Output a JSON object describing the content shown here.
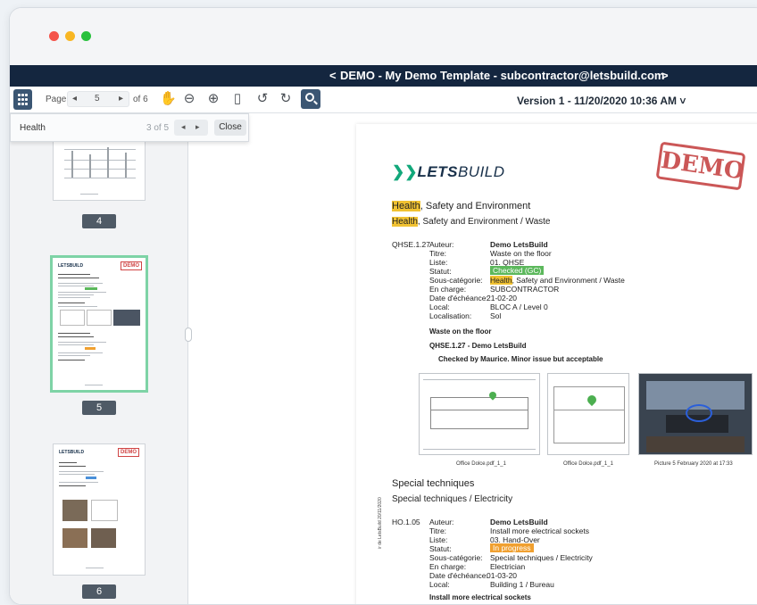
{
  "window": {
    "nav_prev": "<",
    "nav_title": "DEMO - My Demo Template - subcontractor@letsbuild.com",
    "nav_next": ">"
  },
  "toolbar": {
    "page_label": "Page",
    "page_prev": "◂",
    "page_value": "5",
    "page_next": "▸",
    "of_label": "of 6",
    "hand_icon": "✋",
    "zoom_out": "⊖",
    "zoom_in": "⊕",
    "fit_icon": "▯",
    "rotate_left": "↺",
    "rotate_right": "↻",
    "version": "Version 1 - 11/20/2020 10:36 AM ˅"
  },
  "search": {
    "query": "Health",
    "count": "3 of 5",
    "prev": "◂",
    "next": "▸",
    "close_label": "Close"
  },
  "thumbnails": [
    {
      "number": "4"
    },
    {
      "number": "5",
      "selected": true
    },
    {
      "number": "6"
    }
  ],
  "thumb_text": {
    "logo": "LETSBUILD",
    "demo": "DEMO"
  },
  "document": {
    "logo_mark": "❯❯",
    "logo_bold": "LETS",
    "logo_light": "BUILD",
    "stamp": "DEMO",
    "section1_hl": "Health",
    "section1_rest": ", Safety and Environment",
    "section1_sub_hl": "Health",
    "section1_sub_rest": ", Safety and Environment / Waste",
    "issue1": {
      "code": "QHSE.1.27",
      "labels": [
        "Auteur:",
        "Titre:",
        "Liste:",
        "Statut:",
        "Sous-catégorie:",
        "En charge:",
        "Date d'échéance:",
        "Local:",
        "Localisation:"
      ],
      "auteur": "Demo LetsBuild",
      "titre": "Waste on the floor",
      "liste": "01. QHSE",
      "statut": "Checked (GC)",
      "statut_color": "#5cb85c",
      "souscat_hl": "Health",
      "souscat_rest": ", Safety and Environment / Waste",
      "en_charge": "SUBCONTRACTOR",
      "date": "21-02-20",
      "local": "BLOC A / Level 0",
      "localisation": "Sol",
      "heading": "Waste on the floor",
      "comment_title": "QHSE.1.27 - Demo LetsBuild",
      "comment": "Checked by Maurice. Minor issue but acceptable",
      "captions": [
        "Office Dolce.pdf_1_1",
        "Office Dolce.pdf_1_1",
        "Picture 5 February 2020 at 17:33"
      ]
    },
    "section2": "Special techniques",
    "section2_sub": "Special techniques / Electricity",
    "issue2": {
      "code": "HO.1.05",
      "labels": [
        "Auteur:",
        "Titre:",
        "Liste:",
        "Statut:",
        "Sous-catégorie:",
        "En charge:",
        "Date d'échéance:",
        "Local:"
      ],
      "auteur": "Demo LetsBuild",
      "titre": "Install more electrical sockets",
      "liste": "03. Hand-Over",
      "statut": "In progress",
      "statut_color": "#f0a030",
      "souscat": "Special techniques / Electricity",
      "en_charge": "Electrician",
      "date": "01-03-20",
      "local": "Building 1 / Bureau",
      "heading": "Install more electrical sockets"
    },
    "side_text": "ir de LetsBuild 20/11/2020"
  }
}
